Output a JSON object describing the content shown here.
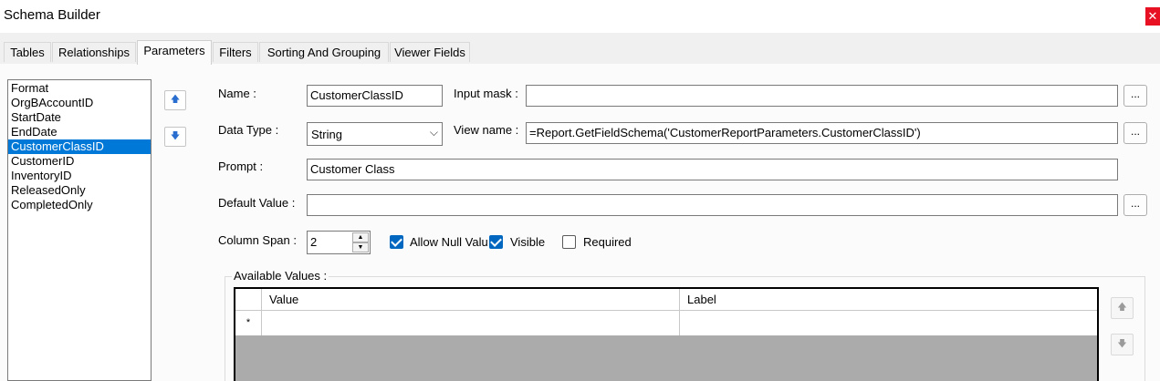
{
  "window": {
    "title": "Schema Builder",
    "close_icon": "close-icon"
  },
  "tabs": [
    {
      "label": "Tables"
    },
    {
      "label": "Relationships"
    },
    {
      "label": "Parameters"
    },
    {
      "label": "Filters"
    },
    {
      "label": "Sorting And Grouping"
    },
    {
      "label": "Viewer Fields"
    }
  ],
  "active_tab": "Parameters",
  "parameters_list": {
    "items": [
      "Format",
      "OrgBAccountID",
      "StartDate",
      "EndDate",
      "CustomerClassID",
      "CustomerID",
      "InventoryID",
      "ReleasedOnly",
      "CompletedOnly"
    ],
    "selected": "CustomerClassID"
  },
  "move_buttons": {
    "up_icon": "arrow-up-icon",
    "down_icon": "arrow-down-icon",
    "up_glyph": "🡅",
    "down_glyph": "🡇"
  },
  "form": {
    "name_label": "Name :",
    "name_value": "CustomerClassID",
    "input_mask_label": "Input mask :",
    "input_mask_value": "",
    "data_type_label": "Data Type :",
    "data_type_value": "String",
    "view_name_label": "View name :",
    "view_name_value": "=Report.GetFieldSchema('CustomerReportParameters.CustomerClassID')",
    "prompt_label": "Prompt :",
    "prompt_value": "Customer Class",
    "default_value_label": "Default Value :",
    "default_value_value": "",
    "column_span_label": "Column Span :",
    "column_span_value": "2",
    "ellipsis": "..."
  },
  "checkboxes": [
    {
      "label": "Allow Null Valu",
      "checked": true
    },
    {
      "label": "Visible",
      "checked": true
    },
    {
      "label": "Required",
      "checked": false
    }
  ],
  "available_values": {
    "title": "Available Values :",
    "columns": [
      "Value",
      "Label"
    ],
    "new_row_marker": "*",
    "rows": []
  },
  "colors": {
    "selection": "#0078d7",
    "checkbox": "#0067c0",
    "close": "#e81123",
    "grid_empty": "#ababab"
  }
}
